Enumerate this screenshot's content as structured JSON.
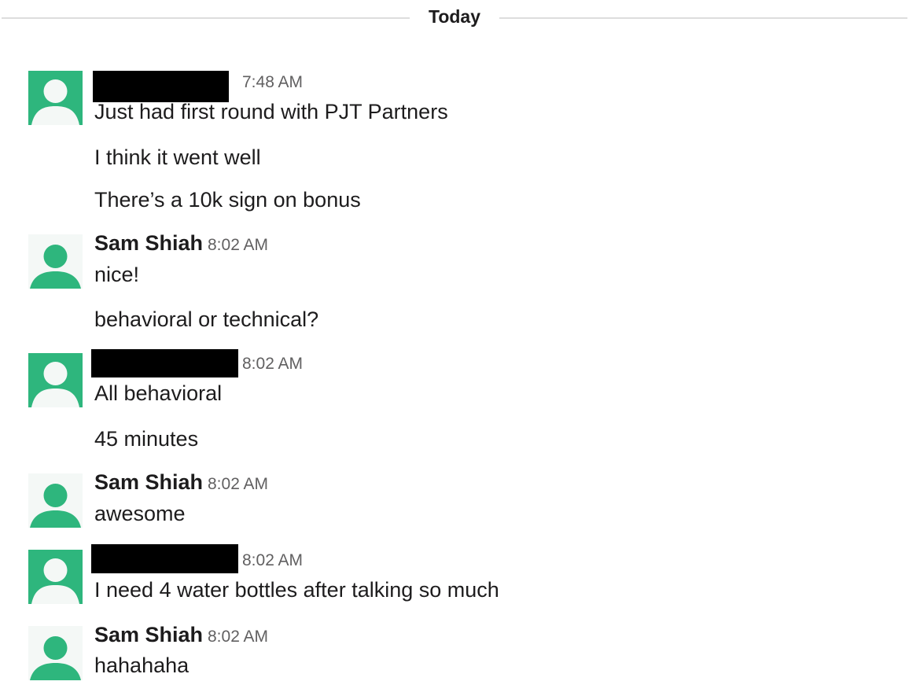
{
  "divider": {
    "label": "Today"
  },
  "colors": {
    "avatar_bg_default": "#2eb67d",
    "avatar_bg_light": "#f4f8f6",
    "avatar_figure": "#2eb67d"
  },
  "icons": {
    "avatar": "user-silhouette-icon"
  },
  "messages": [
    {
      "author": "",
      "redacted": true,
      "time": "7:48 AM",
      "lines": [
        "Just had first round with PJT Partners",
        "I think it went well",
        "There’s a 10k sign on bonus"
      ]
    },
    {
      "author": "Sam Shiah",
      "redacted": false,
      "time": "8:02 AM",
      "lines": [
        "nice!",
        "behavioral or technical?"
      ]
    },
    {
      "author": "",
      "redacted": true,
      "time": "8:02 AM",
      "lines": [
        "All behavioral",
        "45 minutes"
      ]
    },
    {
      "author": "Sam Shiah",
      "redacted": false,
      "time": "8:02 AM",
      "lines": [
        "awesome"
      ]
    },
    {
      "author": "",
      "redacted": true,
      "time": "8:02 AM",
      "lines": [
        "I need 4 water bottles after talking so much"
      ]
    },
    {
      "author": "Sam Shiah",
      "redacted": false,
      "time": "8:02 AM",
      "lines": [
        "hahahaha"
      ]
    }
  ]
}
